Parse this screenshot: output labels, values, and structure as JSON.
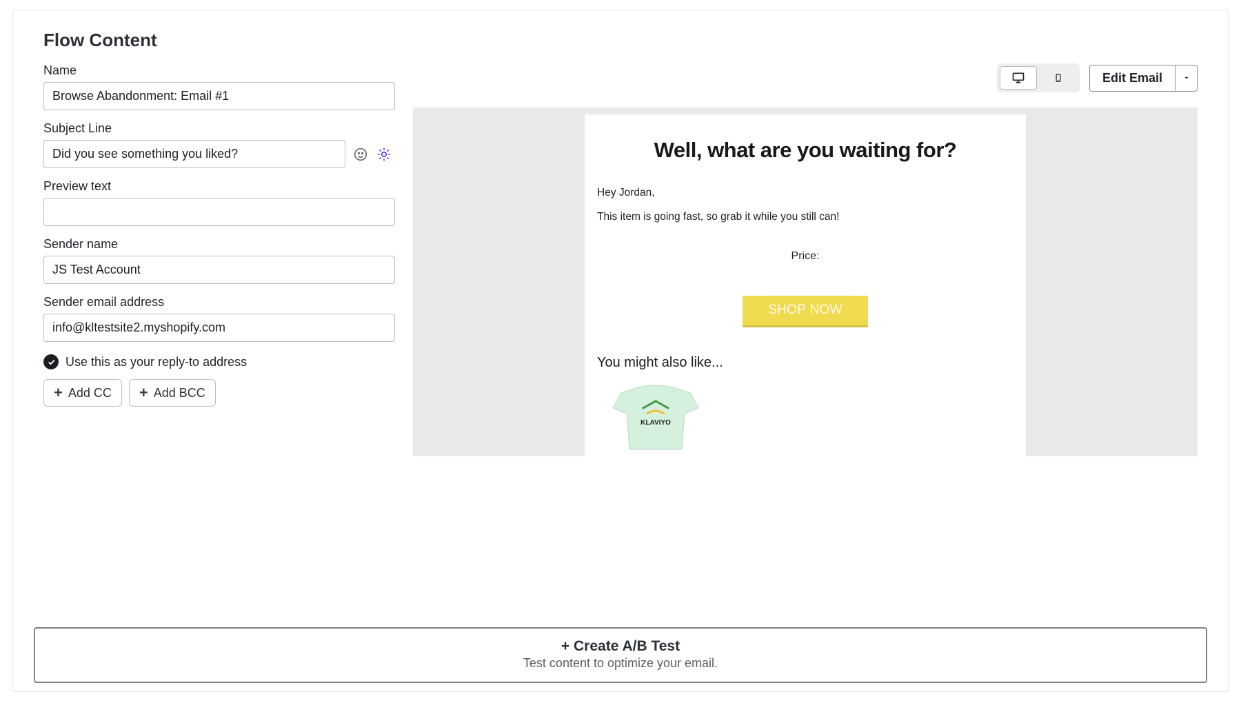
{
  "page_title": "Flow Content",
  "fields": {
    "name_label": "Name",
    "name_value": "Browse Abandonment: Email #1",
    "subject_label": "Subject Line",
    "subject_value": "Did you see something you liked?",
    "preview_label": "Preview text",
    "preview_value": "",
    "sender_name_label": "Sender name",
    "sender_name_value": "JS Test Account",
    "sender_email_label": "Sender email address",
    "sender_email_value": "info@kltestsite2.myshopify.com",
    "reply_to_label": "Use this as your reply-to address",
    "add_cc_label": "Add CC",
    "add_bcc_label": "Add BCC"
  },
  "toolbar": {
    "edit_label": "Edit Email"
  },
  "preview": {
    "headline": "Well, what are you waiting for?",
    "greeting": "Hey Jordan,",
    "body_line": "This item is going fast, so grab it while you still can!",
    "price_label": "Price:",
    "cta": "SHOP NOW",
    "also_like": "You might also like...",
    "product_brand": "KLAVIYO"
  },
  "abtest": {
    "title": "+ Create A/B Test",
    "subtitle": "Test content to optimize your email."
  }
}
